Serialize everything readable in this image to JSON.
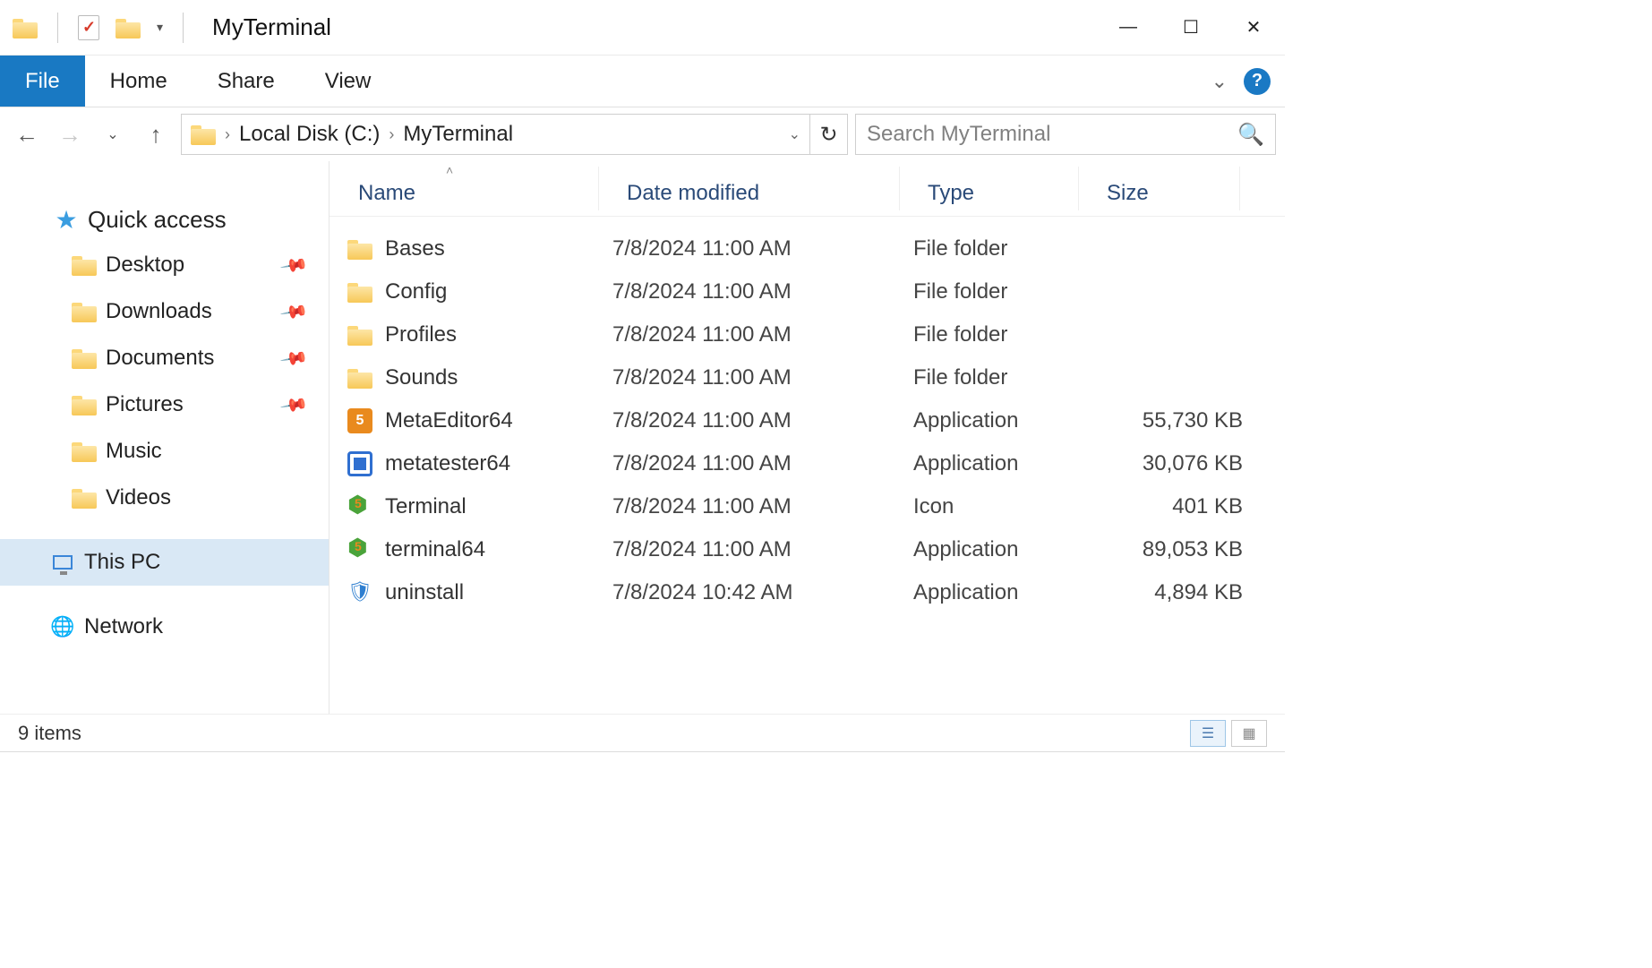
{
  "window": {
    "title": "MyTerminal"
  },
  "ribbon": {
    "file": "File",
    "home": "Home",
    "share": "Share",
    "view": "View"
  },
  "breadcrumb": {
    "part1": "Local Disk (C:)",
    "part2": "MyTerminal"
  },
  "search": {
    "placeholder": "Search MyTerminal"
  },
  "nav": {
    "quick_access": "Quick access",
    "desktop": "Desktop",
    "downloads": "Downloads",
    "documents": "Documents",
    "pictures": "Pictures",
    "music": "Music",
    "videos": "Videos",
    "this_pc": "This PC",
    "network": "Network"
  },
  "columns": {
    "name": "Name",
    "date": "Date modified",
    "type": "Type",
    "size": "Size"
  },
  "files": [
    {
      "icon": "folder",
      "name": "Bases",
      "date": "7/8/2024 11:00 AM",
      "type": "File folder",
      "size": ""
    },
    {
      "icon": "folder",
      "name": "Config",
      "date": "7/8/2024 11:00 AM",
      "type": "File folder",
      "size": ""
    },
    {
      "icon": "folder",
      "name": "Profiles",
      "date": "7/8/2024 11:00 AM",
      "type": "File folder",
      "size": ""
    },
    {
      "icon": "folder",
      "name": "Sounds",
      "date": "7/8/2024 11:00 AM",
      "type": "File folder",
      "size": ""
    },
    {
      "icon": "app-orange",
      "name": "MetaEditor64",
      "date": "7/8/2024 11:00 AM",
      "type": "Application",
      "size": "55,730 KB"
    },
    {
      "icon": "app-blue",
      "name": "metatester64",
      "date": "7/8/2024 11:00 AM",
      "type": "Application",
      "size": "30,076 KB"
    },
    {
      "icon": "app-green",
      "name": "Terminal",
      "date": "7/8/2024 11:00 AM",
      "type": "Icon",
      "size": "401 KB"
    },
    {
      "icon": "app-green",
      "name": "terminal64",
      "date": "7/8/2024 11:00 AM",
      "type": "Application",
      "size": "89,053 KB"
    },
    {
      "icon": "app-uninstall",
      "name": "uninstall",
      "date": "7/8/2024 10:42 AM",
      "type": "Application",
      "size": "4,894 KB"
    }
  ],
  "status": {
    "items": "9 items"
  }
}
